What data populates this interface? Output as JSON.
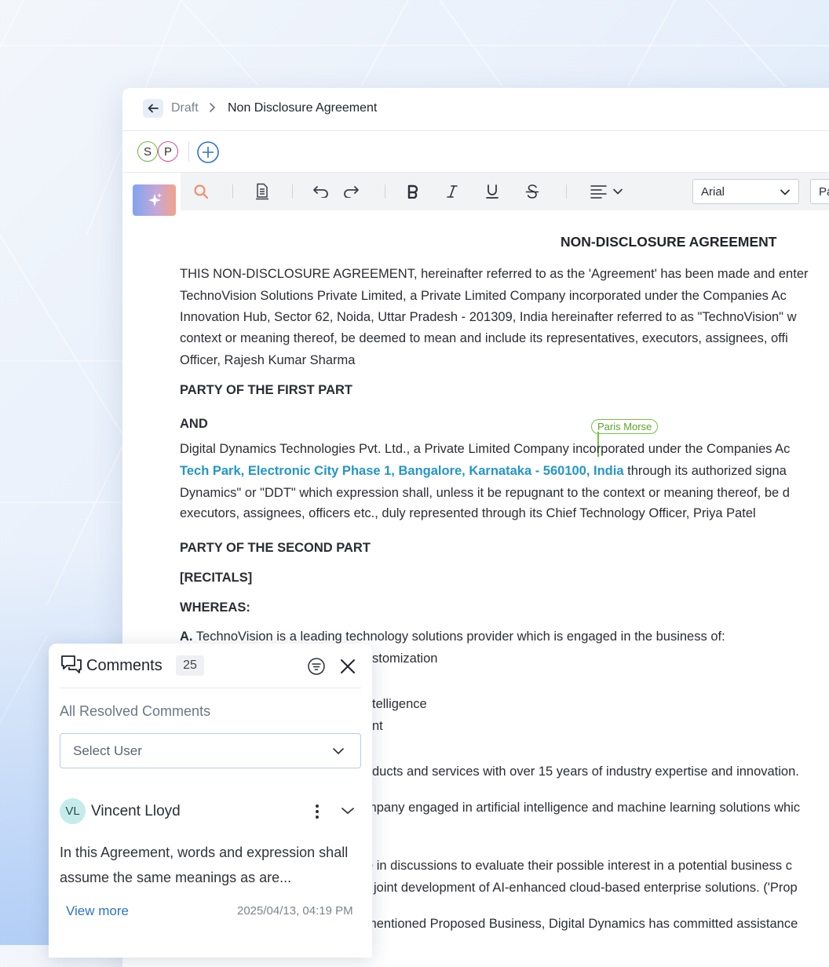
{
  "breadcrumb": {
    "draft": "Draft",
    "title": "Non Disclosure Agreement"
  },
  "collaborators": [
    {
      "initial": "S",
      "color": "#6dbb3c"
    },
    {
      "initial": "P",
      "color": "#d64f8e"
    }
  ],
  "toolbar": {
    "font": "Arial",
    "style": "Paragraph"
  },
  "document": {
    "title": "NON-DISCLOSURE AGREEMENT",
    "p1": [
      "THIS NON-DISCLOSURE AGREEMENT, hereinafter referred to as the 'Agreement' has been made and enter",
      "TechnoVision Solutions Private Limited, a Private Limited Company incorporated under the Companies Ac",
      "Innovation Hub, Sector 62, Noida, Uttar Pradesh - 201309, India hereinafter referred to as \"TechnoVision\" w",
      "context or meaning thereof, be deemed to mean and include its representatives, executors, assignees, offi",
      "Officer, Rajesh Kumar Sharma"
    ],
    "first_party": "PARTY OF THE FIRST PART",
    "and": "AND",
    "cursor_user": "Paris Morse",
    "p2_line1": "Digital Dynamics Technologies Pvt. Ltd., a Private Limited Company incorporated under the Companies Ac",
    "p2_link": "Tech Park, Electronic City Phase 1, Bangalore, Karnataka - 560100, India",
    "p2_line2_rest": " through its authorized signa",
    "p2_line3": "Dynamics\" or \"DDT\" which expression shall, unless it be repugnant to the context or meaning thereof, be d",
    "p2_line4": "executors, assignees, officers etc., duly represented through its Chief Technology Officer, Priya Patel",
    "second_party": "PARTY OF THE SECOND PART",
    "recitals": "[RECITALS]",
    "whereas": "WHEREAS:",
    "a_label": "A.",
    "a_text": " TechnoVision is a leading technology solutions provider which is engaged in the business of:",
    "frag1": "stomization",
    "frag2": "telligence",
    "frag3": "nt",
    "frag4": "ducts and services with over 15 years of industry expertise and innovation.",
    "frag5": "mpany engaged in artificial intelligence and machine learning solutions whic",
    "frag6": "e in discussions to evaluate their possible interest in a potential business c",
    "frag7": "joint development of AI-enhanced cloud-based enterprise solutions. ('Prop",
    "frag8": "mentioned Proposed Business, Digital Dynamics has committed assistance"
  },
  "comments": {
    "title": "Comments",
    "count": "25",
    "filter_label": "All Resolved Comments",
    "select_placeholder": "Select User",
    "item": {
      "initials": "VL",
      "name": "Vincent Lloyd",
      "text": "In this Agreement, words and expression shall assume the same meanings as are...",
      "view_more": "View more",
      "timestamp": "2025/04/13, 04:19 PM"
    }
  }
}
